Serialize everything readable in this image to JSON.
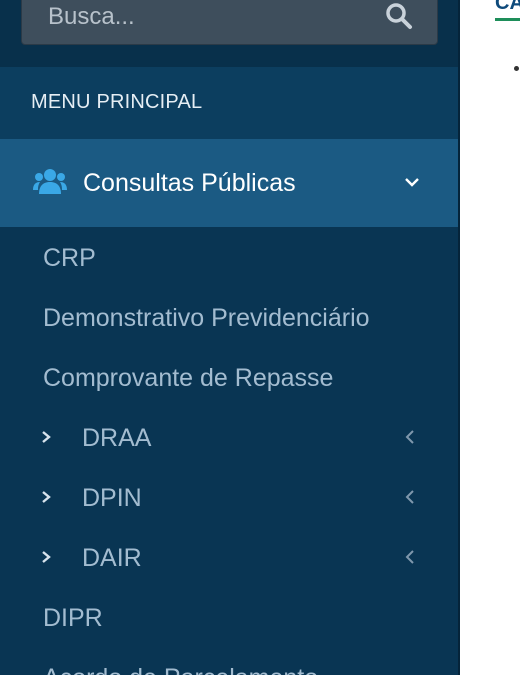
{
  "search": {
    "placeholder": "Busca..."
  },
  "menu": {
    "header": "MENU PRINCIPAL",
    "active_item": {
      "label": "Consultas Públicas",
      "icon": "users-icon",
      "icon_color": "#3aa8e6"
    },
    "submenu": [
      {
        "label": "CRP",
        "has_children": false
      },
      {
        "label": "Demonstrativo Previdenciário",
        "has_children": false
      },
      {
        "label": "Comprovante de Repasse",
        "has_children": false
      },
      {
        "label": "DRAA",
        "has_children": true
      },
      {
        "label": "DPIN",
        "has_children": true
      },
      {
        "label": "DAIR",
        "has_children": true
      },
      {
        "label": "DIPR",
        "has_children": false
      },
      {
        "label": "Acordo de Parcelamento",
        "has_children": false
      }
    ]
  },
  "content": {
    "title_partial": "CA"
  },
  "colors": {
    "sidebar_bg": "#093553",
    "active_bg": "#1b5a83",
    "submenu_text": "#a3bcd0",
    "accent_underline": "#1e8e5a"
  }
}
